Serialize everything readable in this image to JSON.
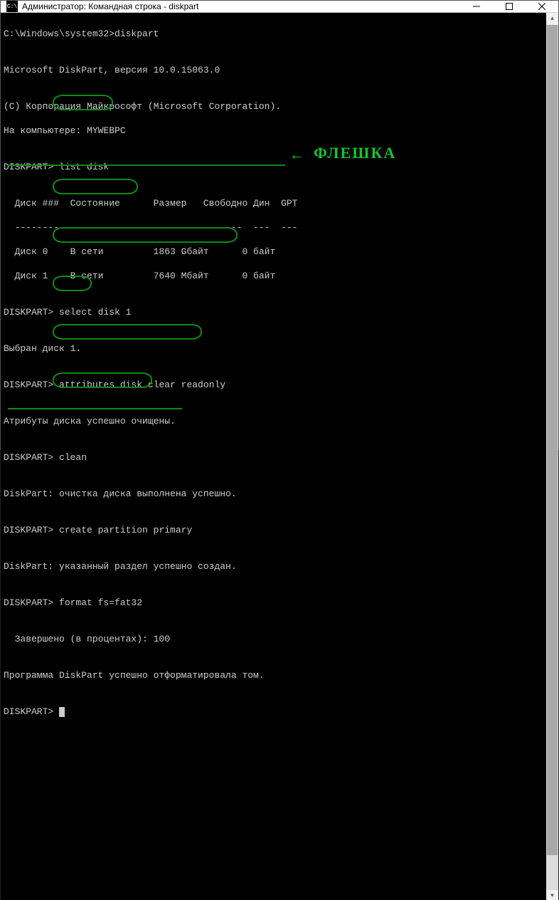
{
  "titlebar": {
    "icon_text": "C:\\",
    "title": "Администратор: Командная строка - diskpart"
  },
  "lines": {
    "l0": "C:\\Windows\\system32>diskpart",
    "l1": "",
    "l2": "Microsoft DiskPart, версия 10.0.15063.0",
    "l3": "",
    "l4": "(C) Корпорация Майкрософт (Microsoft Corporation).",
    "l5": "На компьютере: MYWEBPC",
    "l6": "",
    "p1": "DISKPART> ",
    "c1": "list disk",
    "l8": "",
    "th": "  Диск ###  Состояние      Размер   Свободно Дин  GPT",
    "tr": "  --------  -------------  -------  -------  ---  ---",
    "td0": "  Диск 0    В сети         1863 Gбайт      0 байт",
    "td1": "  Диск 1    В сети         7640 Mбайт      0 байт",
    "l13": "",
    "p2": "DISKPART> ",
    "c2": "select disk 1",
    "l15": "",
    "l16": "Выбран диск 1.",
    "l17": "",
    "p3": "DISKPART> ",
    "c3": "attributes disk clear readonly",
    "l19": "",
    "l20": "Атрибуты диска успешно очищены.",
    "l21": "",
    "p4": "DISKPART> ",
    "c4": "clean",
    "l23": "",
    "l24": "DiskPart: очистка диска выполнена успешно.",
    "l25": "",
    "p5": "DISKPART> ",
    "c5": "create partition primary",
    "l27": "",
    "l28": "DiskPart: указанный раздел успешно создан.",
    "l29": "",
    "p6": "DISKPART> ",
    "c6": "format fs=fat32",
    "l31": "",
    "l32": "  Завершено (в процентах): 100",
    "l33": "",
    "l34": "Программа DiskPart успешно отформатировала том.",
    "l35": "",
    "p7": "DISKPART> "
  },
  "annotations": {
    "fleshka_arrow": "←",
    "fleshka_text": "ФЛЕШКА"
  }
}
